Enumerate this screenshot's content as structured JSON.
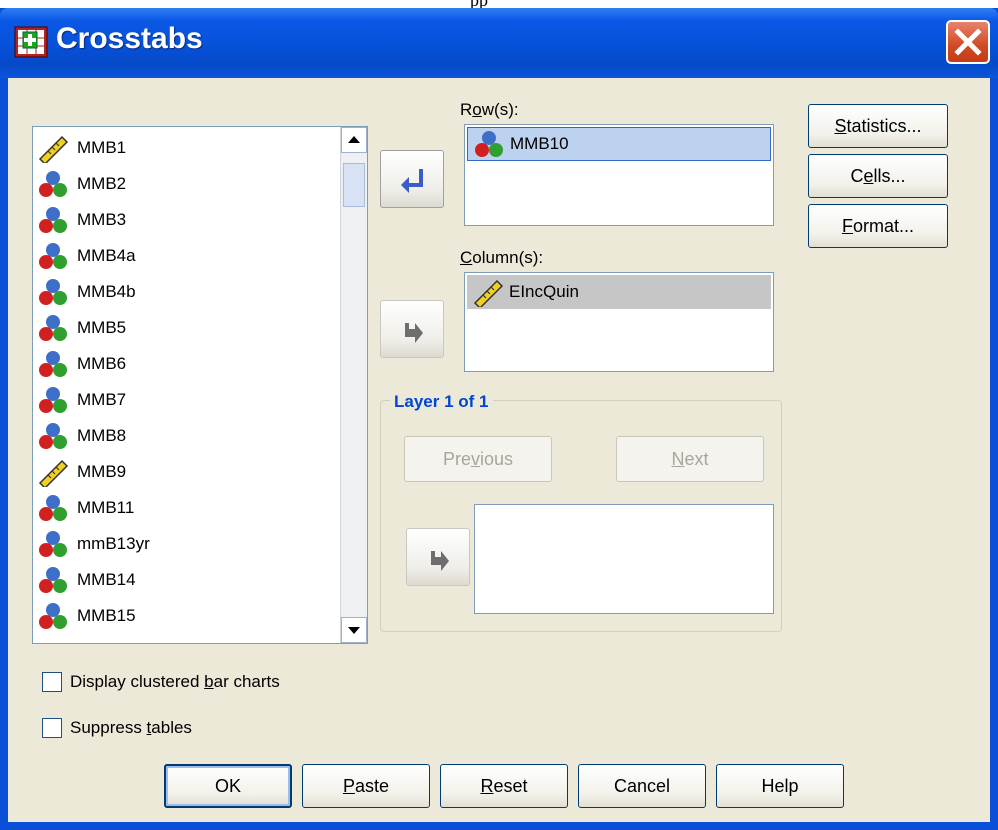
{
  "page_top_text": "pp",
  "window": {
    "title": "Crosstabs"
  },
  "variables": [
    {
      "name": "MMB1",
      "icon": "ruler-icon"
    },
    {
      "name": "MMB2",
      "icon": "nominal-icon"
    },
    {
      "name": "MMB3",
      "icon": "nominal-icon"
    },
    {
      "name": "MMB4a",
      "icon": "nominal-icon"
    },
    {
      "name": "MMB4b",
      "icon": "nominal-icon"
    },
    {
      "name": "MMB5",
      "icon": "nominal-icon"
    },
    {
      "name": "MMB6",
      "icon": "nominal-icon"
    },
    {
      "name": "MMB7",
      "icon": "nominal-icon"
    },
    {
      "name": "MMB8",
      "icon": "nominal-icon"
    },
    {
      "name": "MMB9",
      "icon": "ruler-icon"
    },
    {
      "name": "MMB11",
      "icon": "nominal-icon"
    },
    {
      "name": "mmB13yr",
      "icon": "nominal-icon"
    },
    {
      "name": "MMB14",
      "icon": "nominal-icon"
    },
    {
      "name": "MMB15",
      "icon": "nominal-icon"
    }
  ],
  "rows": {
    "label_pre": "R",
    "label_u": "o",
    "label_post": "w(s):",
    "item": "MMB10"
  },
  "columns": {
    "label_pre": "",
    "label_u": "C",
    "label_post": "olumn(s):",
    "item": "EIncQuin"
  },
  "layer": {
    "title": "Layer 1 of 1",
    "previous_pre": "Pre",
    "previous_u": "v",
    "previous_post": "ious",
    "next_pre": "",
    "next_u": "N",
    "next_post": "ext"
  },
  "side_buttons": {
    "statistics_u": "S",
    "statistics_post": "tatistics...",
    "cells_pre": "C",
    "cells_u": "e",
    "cells_post": "lls...",
    "format_u": "F",
    "format_post": "ormat..."
  },
  "options": {
    "clustered_pre": "Display clustered ",
    "clustered_u": "b",
    "clustered_post": "ar charts",
    "clustered_checked": false,
    "suppress_pre": "Suppress ",
    "suppress_u": "t",
    "suppress_post": "ables",
    "suppress_checked": false
  },
  "footer": {
    "ok": "OK",
    "paste_u": "P",
    "paste_post": "aste",
    "reset_u": "R",
    "reset_post": "eset",
    "cancel": "Cancel",
    "help": "Help"
  }
}
